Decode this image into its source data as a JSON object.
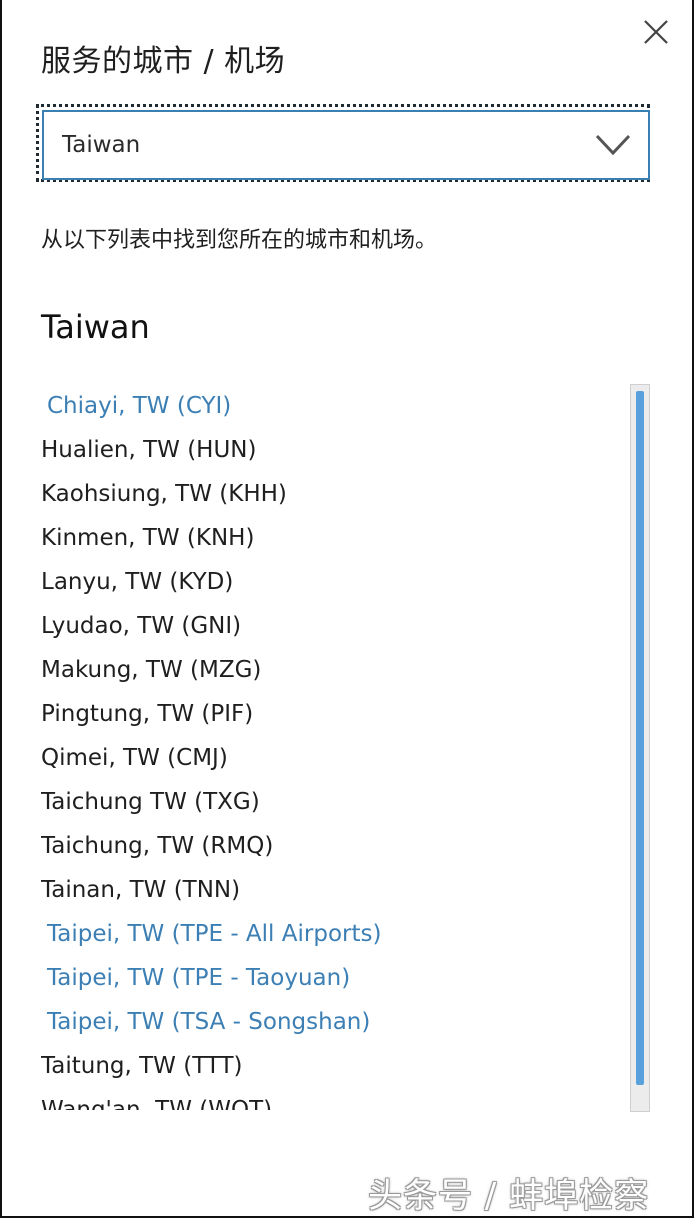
{
  "dialog": {
    "title": "服务的城市 / 机场",
    "close_icon": "close-icon"
  },
  "country_select": {
    "value": "Taiwan",
    "icon": "chevron-down-icon"
  },
  "hint_text": "从以下列表中找到您所在的城市和机场。",
  "section_title": "Taiwan",
  "airports": [
    {
      "label": "Chiayi, TW (CYI)",
      "link": true
    },
    {
      "label": "Hualien, TW (HUN)",
      "link": false
    },
    {
      "label": "Kaohsiung, TW (KHH)",
      "link": false
    },
    {
      "label": "Kinmen, TW (KNH)",
      "link": false
    },
    {
      "label": "Lanyu, TW (KYD)",
      "link": false
    },
    {
      "label": "Lyudao, TW (GNI)",
      "link": false
    },
    {
      "label": "Makung, TW (MZG)",
      "link": false
    },
    {
      "label": "Pingtung, TW (PIF)",
      "link": false
    },
    {
      "label": "Qimei, TW (CMJ)",
      "link": false
    },
    {
      "label": "Taichung TW (TXG)",
      "link": false
    },
    {
      "label": "Taichung, TW (RMQ)",
      "link": false
    },
    {
      "label": "Tainan, TW (TNN)",
      "link": false
    },
    {
      "label": "Taipei, TW (TPE - All Airports)",
      "link": true
    },
    {
      "label": "Taipei, TW (TPE - Taoyuan)",
      "link": true
    },
    {
      "label": "Taipei, TW (TSA - Songshan)",
      "link": true
    },
    {
      "label": "Taitung, TW (TTT)",
      "link": false
    },
    {
      "label": "Wang'an, TW (WOT)",
      "link": false
    }
  ],
  "colors": {
    "link": "#3c7fb4",
    "scrollbar_thumb": "#5aa0dd",
    "select_border": "#3a7fb1"
  },
  "watermark": "头条号 / 蚌埠检察"
}
